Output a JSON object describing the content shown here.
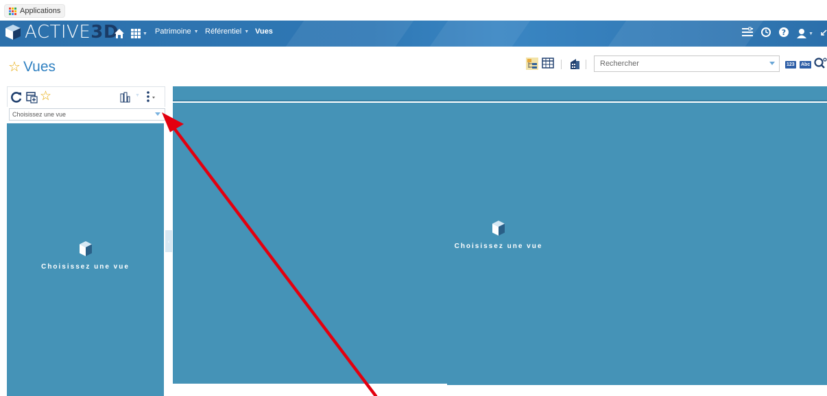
{
  "browser": {
    "bookmark_apps": "Applications"
  },
  "header": {
    "logo_main": "ACTIVE",
    "logo_accent": "3D",
    "nav": [
      {
        "label": "Patrimoine"
      },
      {
        "label": "Référentiel"
      },
      {
        "label": "Vues"
      }
    ]
  },
  "titlebar": {
    "title": "Vues",
    "search": {
      "placeholder": "Rechercher",
      "value": ""
    },
    "tag_numeric": "123",
    "tag_text": "Abc"
  },
  "left_panel": {
    "select": {
      "value": "Choisissez une vue"
    },
    "empty_message": "Choisissez une vue"
  },
  "main_panel": {
    "empty_message": "Choisissez une vue"
  },
  "colors": {
    "header_blue": "#2c70ab",
    "panel_blue": "#4593b7",
    "title_blue": "#2f80c1",
    "arrow_red": "#e3000f"
  }
}
